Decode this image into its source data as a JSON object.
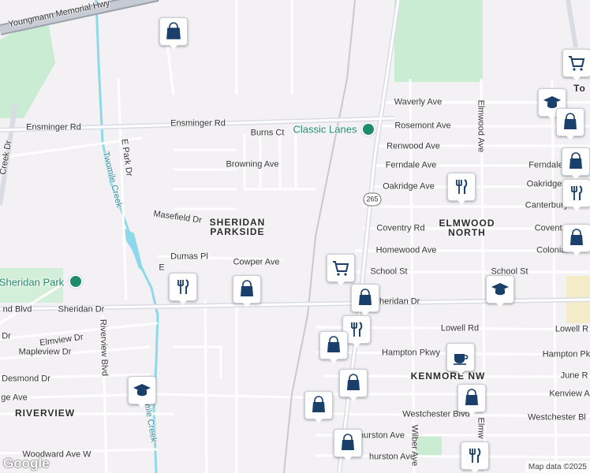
{
  "map": {
    "roads": [
      {
        "id": "hwy",
        "label": "Youngmann Memorial Hwy"
      },
      {
        "id": "ensminger",
        "label": "Ensminger Rd"
      },
      {
        "id": "sheridan_dr",
        "label": "Sheridan Dr"
      },
      {
        "id": "sheridan_blvd",
        "label": "nd Blvd"
      },
      {
        "id": "e_park",
        "label": "E Park Dr"
      },
      {
        "id": "burns",
        "label": "Burns Ct"
      },
      {
        "id": "browning",
        "label": "Browning Ave"
      },
      {
        "id": "masefield",
        "label": "Masefield Dr"
      },
      {
        "id": "dumas",
        "label": "Dumas Pl"
      },
      {
        "id": "cowper",
        "label": "Cowper Ave"
      },
      {
        "id": "waverly",
        "label": "Waverly Ave"
      },
      {
        "id": "rosemont",
        "label": "Rosemont Ave"
      },
      {
        "id": "renwood",
        "label": "Renwood Ave"
      },
      {
        "id": "ferndale",
        "label": "Ferndale Ave"
      },
      {
        "id": "ferndale2",
        "label": "Ferndale"
      },
      {
        "id": "oakridge",
        "label": "Oakridge Ave"
      },
      {
        "id": "oakridge2",
        "label": "Oakridge"
      },
      {
        "id": "canterbury",
        "label": "Canterbury"
      },
      {
        "id": "coventry",
        "label": "Coventry Rd"
      },
      {
        "id": "coventry2",
        "label": "Coventr"
      },
      {
        "id": "homewood",
        "label": "Homewood Ave"
      },
      {
        "id": "colonial",
        "label": "Colonial"
      },
      {
        "id": "school",
        "label": "School St"
      },
      {
        "id": "school2",
        "label": "School St"
      },
      {
        "id": "sheridan_dr2",
        "label": "Sheridan Dr"
      },
      {
        "id": "lowell",
        "label": "Lowell Rd"
      },
      {
        "id": "lowell2",
        "label": "Lowell R"
      },
      {
        "id": "hampton",
        "label": "Hampton Pkwy"
      },
      {
        "id": "hampton2",
        "label": "Hampton Pk"
      },
      {
        "id": "june",
        "label": "June R"
      },
      {
        "id": "kenview",
        "label": "Kenview A"
      },
      {
        "id": "westchester",
        "label": "Westchester Blvd"
      },
      {
        "id": "westchester2",
        "label": "Westchester Bl"
      },
      {
        "id": "thurston",
        "label": "hurston Ave"
      },
      {
        "id": "thurston2",
        "label": "hurston Ave"
      },
      {
        "id": "elmwood",
        "label": "Elmwood Ave"
      },
      {
        "id": "elmw",
        "label": "Elmw"
      },
      {
        "id": "wilber",
        "label": "Wilber Ave"
      },
      {
        "id": "elmview",
        "label": "Elmview Dr"
      },
      {
        "id": "mapleview",
        "label": "Mapleview Dr"
      },
      {
        "id": "desmond",
        "label": "Desmond Dr"
      },
      {
        "id": "ge_ave",
        "label": "ge Ave"
      },
      {
        "id": "riverview_blvd",
        "label": "Riverview Blvd"
      },
      {
        "id": "woodward",
        "label": "Woodward Ave W"
      },
      {
        "id": "creek_rd",
        "label": "Creek Dr"
      },
      {
        "id": "dr_e",
        "label": "E"
      },
      {
        "id": "dr_small",
        "label": "Dr"
      },
      {
        "id": "w_ext",
        "label": "nston Ave"
      }
    ],
    "areas": [
      {
        "id": "sheridan_parkside",
        "label": "SHERIDAN\nPARKSIDE"
      },
      {
        "id": "elmwood_north",
        "label": "ELMWOOD\nNORTH"
      },
      {
        "id": "kenmore_nw",
        "label": "KENMORE NW"
      },
      {
        "id": "riverview",
        "label": "RIVERVIEW"
      },
      {
        "id": "tonawanda",
        "label": "To"
      }
    ],
    "water": [
      {
        "id": "twomile_creek",
        "label": "Twomile Creek"
      },
      {
        "id": "twomile_creek2",
        "label": "mile Creek"
      }
    ],
    "places": [
      {
        "id": "classic_lanes",
        "label": "Classic Lanes"
      },
      {
        "id": "sheridan_park",
        "label": "Sheridan Park"
      }
    ],
    "shield": "265",
    "markers": [
      {
        "icon": "shopping-bag",
        "name": "shopping-marker"
      },
      {
        "icon": "shopping-cart",
        "name": "cart-marker"
      },
      {
        "icon": "restaurant",
        "name": "restaurant-marker"
      },
      {
        "icon": "school",
        "name": "school-marker"
      },
      {
        "icon": "cafe",
        "name": "cafe-marker"
      }
    ],
    "colors": {
      "marker_icon": "#1a3f6b",
      "road": "#ffffff",
      "major_road": "#d9dce3",
      "park": "#c9ecd3",
      "water": "#8dd8ea",
      "poi_green": "#1e8c68"
    }
  },
  "footer": {
    "logo": "Google",
    "credit": "Map data ©2025"
  }
}
